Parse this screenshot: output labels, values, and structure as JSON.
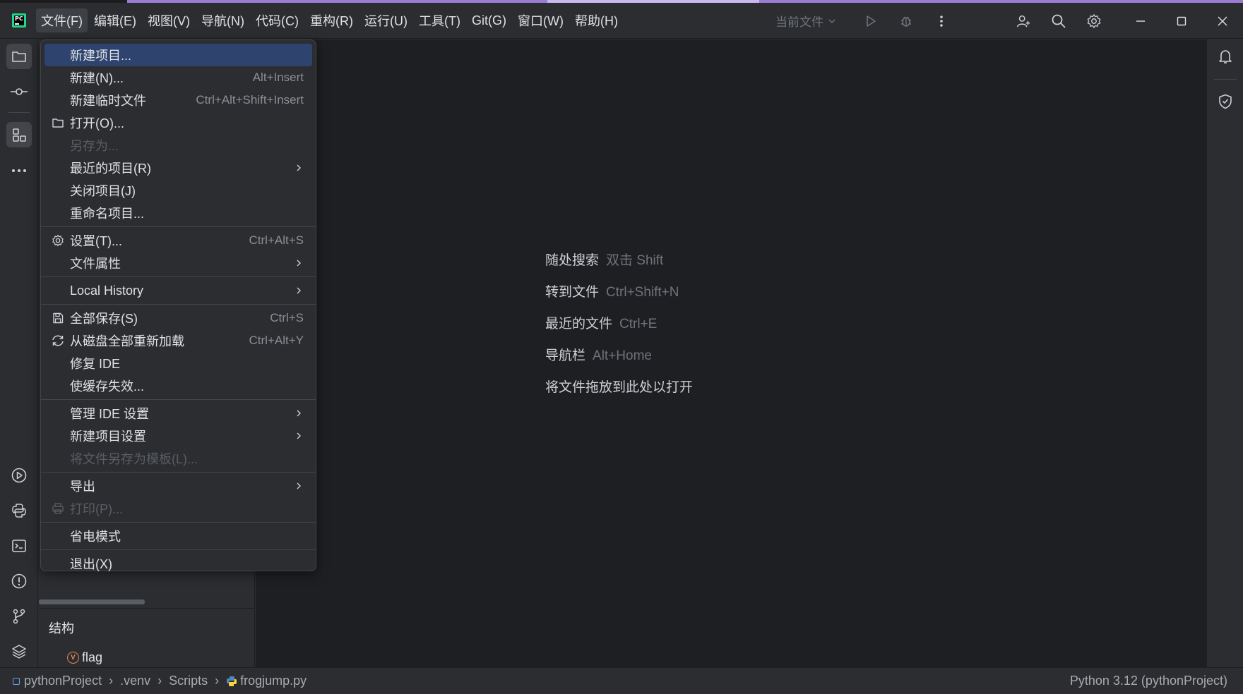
{
  "menubar": [
    {
      "label": "文件(F)",
      "active": true
    },
    {
      "label": "编辑(E)"
    },
    {
      "label": "视图(V)"
    },
    {
      "label": "导航(N)"
    },
    {
      "label": "代码(C)"
    },
    {
      "label": "重构(R)"
    },
    {
      "label": "运行(U)"
    },
    {
      "label": "工具(T)"
    },
    {
      "label": "Git(G)"
    },
    {
      "label": "窗口(W)"
    },
    {
      "label": "帮助(H)"
    }
  ],
  "toolbar": {
    "run_config": "当前文件"
  },
  "file_menu": {
    "new_project": "新建项目...",
    "new": "新建(N)...",
    "new_shortcut": "Alt+Insert",
    "new_scratch": "新建临时文件",
    "new_scratch_shortcut": "Ctrl+Alt+Shift+Insert",
    "open": "打开(O)...",
    "save_as": "另存为...",
    "recent_projects": "最近的项目(R)",
    "close_project": "关闭项目(J)",
    "rename_project": "重命名项目...",
    "settings": "设置(T)...",
    "settings_shortcut": "Ctrl+Alt+S",
    "file_properties": "文件属性",
    "local_history": "Local History",
    "save_all": "全部保存(S)",
    "save_all_shortcut": "Ctrl+S",
    "reload_all": "从磁盘全部重新加载",
    "reload_all_shortcut": "Ctrl+Alt+Y",
    "repair_ide": "修复 IDE",
    "invalidate_caches": "使缓存失效...",
    "manage_ide_settings": "管理 IDE 设置",
    "new_project_setup": "新建项目设置",
    "save_as_template": "将文件另存为模板(L)...",
    "export": "导出",
    "print": "打印(P)...",
    "power_save": "省电模式",
    "exit": "退出(X)"
  },
  "editor_hints": [
    {
      "label": "随处搜索",
      "shortcut": "双击 Shift"
    },
    {
      "label": "转到文件",
      "shortcut": "Ctrl+Shift+N"
    },
    {
      "label": "最近的文件",
      "shortcut": "Ctrl+E"
    },
    {
      "label": "导航栏",
      "shortcut": "Alt+Home"
    },
    {
      "label": "将文件拖放到此处以打开",
      "shortcut": ""
    }
  ],
  "structure": {
    "title": "结构",
    "item": "flag",
    "badge": "V"
  },
  "statusbar": {
    "crumbs": [
      "pythonProject",
      ".venv",
      "Scripts",
      "frogjump.py"
    ],
    "interpreter": "Python 3.12 (pythonProject)"
  },
  "colors": {
    "accent": "#2e436e",
    "brand": "#21d789",
    "background": "#2b2d30",
    "editor": "#1e1f22"
  }
}
